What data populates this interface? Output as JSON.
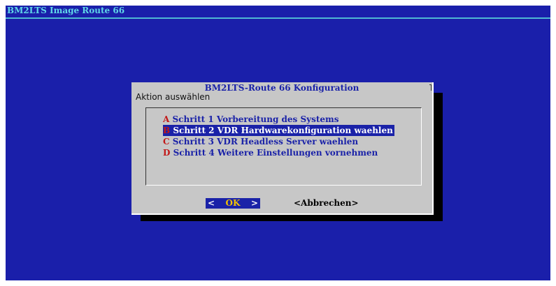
{
  "screen": {
    "backtitle": "BM2LTS Image Route 66"
  },
  "dialog": {
    "title": "BM2LTS-Route 66 Konfiguration",
    "prompt": "Aktion auswählen",
    "items": [
      {
        "key": "A",
        "label": "Schritt 1 Vorbereitung des Systems"
      },
      {
        "key": "B",
        "label": "Schritt 2 VDR Hardwarekonfiguration waehlen"
      },
      {
        "key": "C",
        "label": "Schritt 3 VDR Headless Server waehlen"
      },
      {
        "key": "D",
        "label": "Schritt 4 Weitere Einstellungen vornehmen"
      }
    ],
    "selected_index": 1,
    "buttons": {
      "ok_left": "<",
      "ok_label": "OK",
      "ok_right": ">",
      "cancel_label": "<Abbrechen>"
    }
  },
  "colors": {
    "background": "#1a1faa",
    "dialog": "#c7c7c7",
    "highlight": "#1a22a8",
    "hotkey": "#c21818",
    "backtitle": "#5fd7e8"
  }
}
